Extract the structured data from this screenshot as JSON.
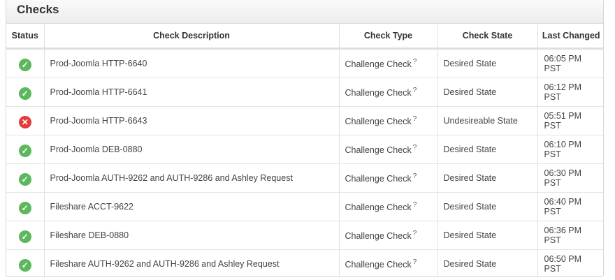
{
  "panel": {
    "title": "Checks"
  },
  "columns": {
    "status": "Status",
    "description": "Check Description",
    "type": "Check Type",
    "state": "Check State",
    "changed": "Last Changed"
  },
  "colors": {
    "ok": "#5cb85c",
    "fail": "#e5393a"
  },
  "rows": [
    {
      "status_icon": "check-circle-icon",
      "status_glyph": "✓",
      "description": "Prod-Joomla HTTP-6640",
      "type": "Challenge Check",
      "help": "?",
      "state": "Desired State",
      "changed": "06:05 PM PST"
    },
    {
      "status_icon": "check-circle-icon",
      "status_glyph": "✓",
      "description": "Prod-Joomla HTTP-6641",
      "type": "Challenge Check",
      "help": "?",
      "state": "Desired State",
      "changed": "06:12 PM PST"
    },
    {
      "status_icon": "error-circle-icon",
      "status_glyph": "✕",
      "description": "Prod-Joomla HTTP-6643",
      "type": "Challenge Check",
      "help": "?",
      "state": "Undesireable State",
      "changed": "05:51 PM PST"
    },
    {
      "status_icon": "check-circle-icon",
      "status_glyph": "✓",
      "description": "Prod-Joomla DEB-0880",
      "type": "Challenge Check",
      "help": "?",
      "state": "Desired State",
      "changed": "06:10 PM PST"
    },
    {
      "status_icon": "check-circle-icon",
      "status_glyph": "✓",
      "description": "Prod-Joomla AUTH-9262 and AUTH-9286 and Ashley Request",
      "type": "Challenge Check",
      "help": "?",
      "state": "Desired State",
      "changed": "06:30 PM PST"
    },
    {
      "status_icon": "check-circle-icon",
      "status_glyph": "✓",
      "description": "Fileshare ACCT-9622",
      "type": "Challenge Check",
      "help": "?",
      "state": "Desired State",
      "changed": "06:40 PM PST"
    },
    {
      "status_icon": "check-circle-icon",
      "status_glyph": "✓",
      "description": "Fileshare DEB-0880",
      "type": "Challenge Check",
      "help": "?",
      "state": "Desired State",
      "changed": "06:36 PM PST"
    },
    {
      "status_icon": "check-circle-icon",
      "status_glyph": "✓",
      "description": "Fileshare AUTH-9262 and AUTH-9286 and Ashley Request",
      "type": "Challenge Check",
      "help": "?",
      "state": "Desired State",
      "changed": "06:50 PM PST"
    }
  ]
}
